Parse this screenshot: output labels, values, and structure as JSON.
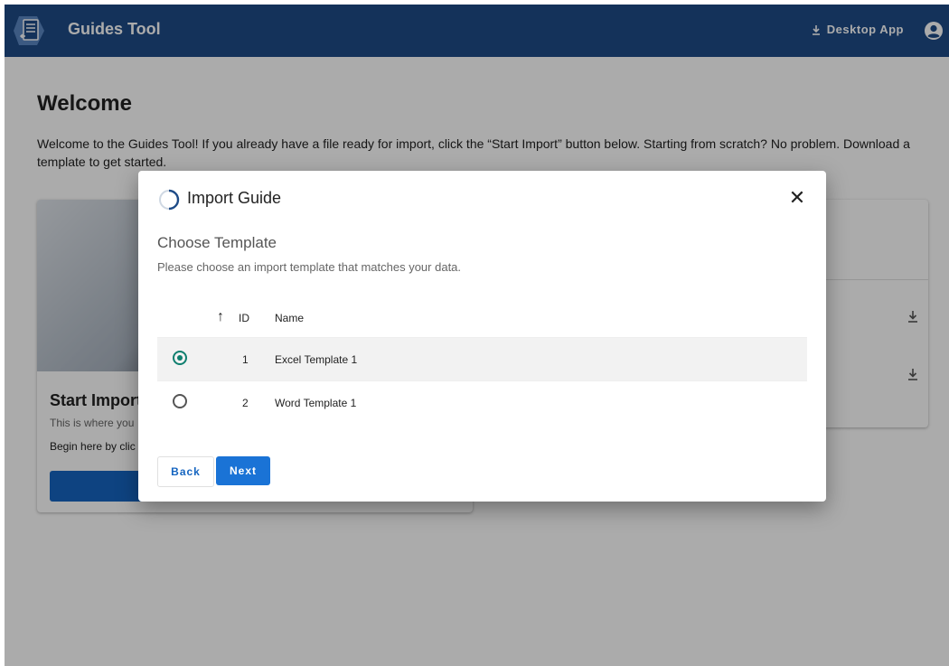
{
  "header": {
    "app_title": "Guides Tool",
    "desktop_app_label": "Desktop App",
    "logo_icon": "document-icon",
    "download_icon": "download-icon",
    "account_icon": "user-circle-icon",
    "brand_color": "#1e4b87"
  },
  "main": {
    "title": "Welcome",
    "intro": "Welcome to the Guides Tool! If you already have a file ready for import, click the “Start Import” button below. Starting from scratch? No problem. Download a template to get started.",
    "start_card": {
      "title": "Start Import",
      "subtitle": "This is where you",
      "text": "Begin here by clic"
    }
  },
  "dialog": {
    "title": "Import Guide",
    "step_title": "Choose Template",
    "step_description": "Please choose an import template that matches your data.",
    "columns": {
      "id": "ID",
      "name": "Name"
    },
    "rows": [
      {
        "id": "1",
        "name": "Excel Template 1",
        "selected": true
      },
      {
        "id": "2",
        "name": "Word Template 1",
        "selected": false
      }
    ],
    "back_label": "Back",
    "next_label": "Next",
    "accent_color": "#0f7f6f"
  }
}
